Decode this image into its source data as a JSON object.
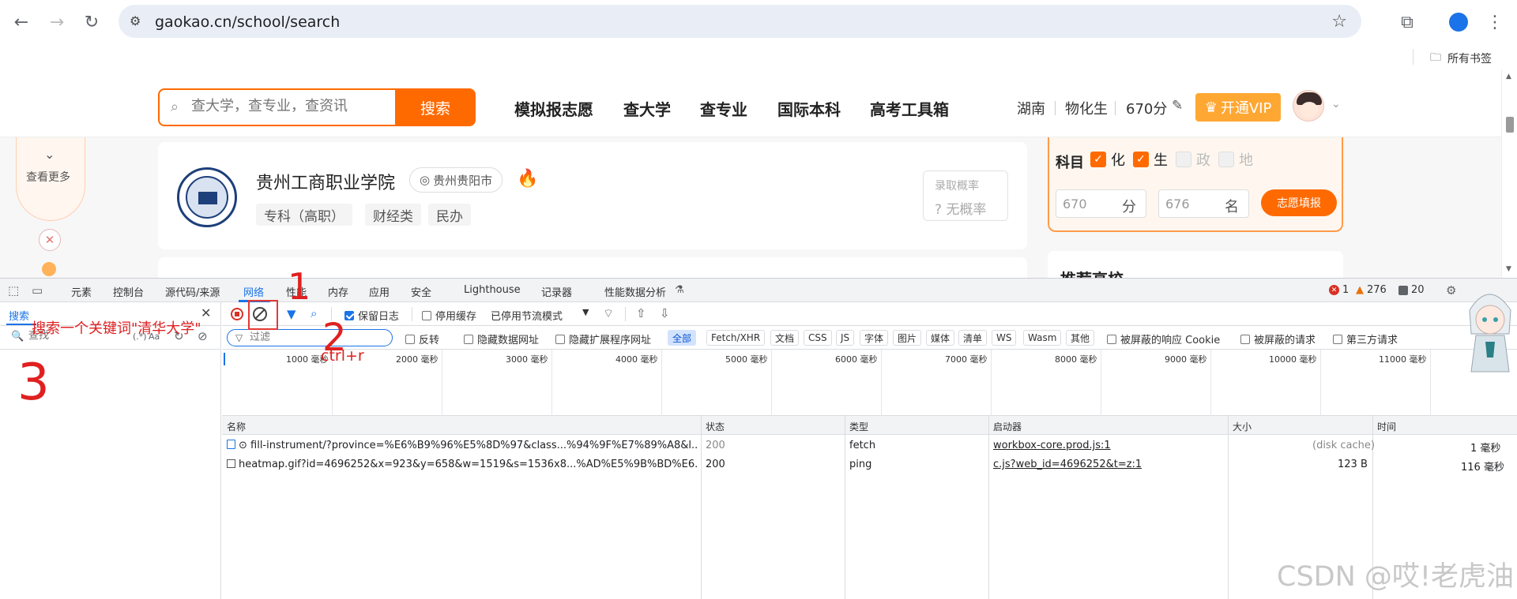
{
  "browser": {
    "url": "gaokao.cn/school/search",
    "bookmarks_folder": "所有书签"
  },
  "site": {
    "search_placeholder": "查大学，查专业，查资讯",
    "search_button": "搜索",
    "nav": [
      "模拟报志愿",
      "查大学",
      "查专业",
      "国际本科",
      "高考工具箱"
    ],
    "province": "湖南",
    "subjects_combo": "物化生",
    "score": "670分",
    "vip_button": "开通VIP",
    "left_more": "查看更多",
    "school": {
      "name": "贵州工商职业学院",
      "location": "贵州贵阳市",
      "tags": [
        "专科（高职）",
        "财经类",
        "民办"
      ],
      "prob_label": "录取概率",
      "prob_value": "无概率"
    },
    "filter_panel": {
      "label": "科目",
      "subjects": [
        {
          "name": "化",
          "checked": true
        },
        {
          "name": "生",
          "checked": true
        },
        {
          "name": "政",
          "checked": false
        },
        {
          "name": "地",
          "checked": false
        }
      ],
      "score_value": "670",
      "score_unit": "分",
      "rank_value": "676",
      "rank_unit": "名",
      "fill_button": "志愿填报"
    },
    "recommend_title": "推荐高校"
  },
  "devtools": {
    "tabs": [
      "元素",
      "控制台",
      "源代码/来源",
      "网络",
      "性能",
      "内存",
      "应用",
      "安全",
      "Lighthouse",
      "记录器",
      "性能数据分析"
    ],
    "active_tab": "网络",
    "errors": "1",
    "warnings": "276",
    "infos": "20",
    "search_pane": {
      "title": "搜索",
      "placeholder": "查找",
      "case_opt": "Aa"
    },
    "toolbar": {
      "preserve_log": "保留日志",
      "disable_cache": "停用缓存",
      "throttle": "已停用节流模式"
    },
    "filter": {
      "placeholder": "过滤",
      "invert": "反转",
      "hide_data_urls": "隐藏数据网址",
      "hide_ext_urls": "隐藏扩展程序网址",
      "types": [
        "全部",
        "Fetch/XHR",
        "文档",
        "CSS",
        "JS",
        "字体",
        "图片",
        "媒体",
        "清单",
        "WS",
        "Wasm",
        "其他"
      ],
      "blocked_cookies": "被屏蔽的响应 Cookie",
      "blocked_requests": "被屏蔽的请求",
      "third_party": "第三方请求"
    },
    "timeline_labels": [
      "1000 毫秒",
      "2000 毫秒",
      "3000 毫秒",
      "4000 毫秒",
      "5000 毫秒",
      "6000 毫秒",
      "7000 毫秒",
      "8000 毫秒",
      "9000 毫秒",
      "10000 毫秒",
      "11000 毫秒"
    ],
    "columns": [
      "名称",
      "状态",
      "类型",
      "启动器",
      "大小",
      "时间"
    ],
    "rows": [
      {
        "name": "⊙ fill-instrument/?province=%E6%B9%96%E5%8D%97&class...%94%9F%E7%89%A8&l...",
        "status": "200",
        "type": "fetch",
        "initiator": "workbox-core.prod.js:1",
        "size": "(disk cache)",
        "time": "1 毫秒"
      },
      {
        "name": "heatmap.gif?id=4696252&x=923&y=658&w=1519&s=1536x8...%AD%E5%9B%BD%E6...",
        "status": "200",
        "type": "ping",
        "initiator": "c.js?web_id=4696252&t=z:1",
        "size": "123 B",
        "time": "116 毫秒"
      }
    ]
  },
  "annotations": {
    "n1": "1",
    "n2": "2",
    "n3": "3",
    "note": "搜索一个关键词\"清华大学\"",
    "shortcut": "ctrl+r"
  },
  "watermark": "CSDN @哎!老虎油",
  "colors": {
    "accent": "#ff6a00",
    "devtools_blue": "#1a73e8",
    "annotation_red": "#e02020"
  }
}
